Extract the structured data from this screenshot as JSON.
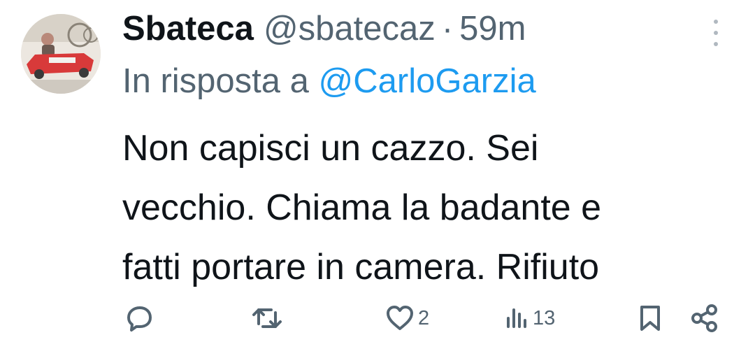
{
  "tweet": {
    "display_name": "Sbateca",
    "handle": "@sbatecaz",
    "separator": "·",
    "time": "59m",
    "reply_prefix": "In risposta a",
    "reply_to": "@CarloGarzia",
    "text_lines": [
      "Non capisci un cazzo. Sei",
      "vecchio. Chiama la badante e",
      "fatti portare in camera. Rifiuto"
    ]
  },
  "actions": {
    "reply_icon": "comment-icon",
    "retweet_icon": "retweet-icon",
    "like_icon": "heart-icon",
    "like_count": "2",
    "views_icon": "views-icon",
    "views_count": "13",
    "bookmark_icon": "bookmark-icon",
    "share_icon": "share-icon"
  },
  "colors": {
    "text": "#0f1419",
    "secondary": "#536471",
    "link": "#1d9bf0"
  }
}
